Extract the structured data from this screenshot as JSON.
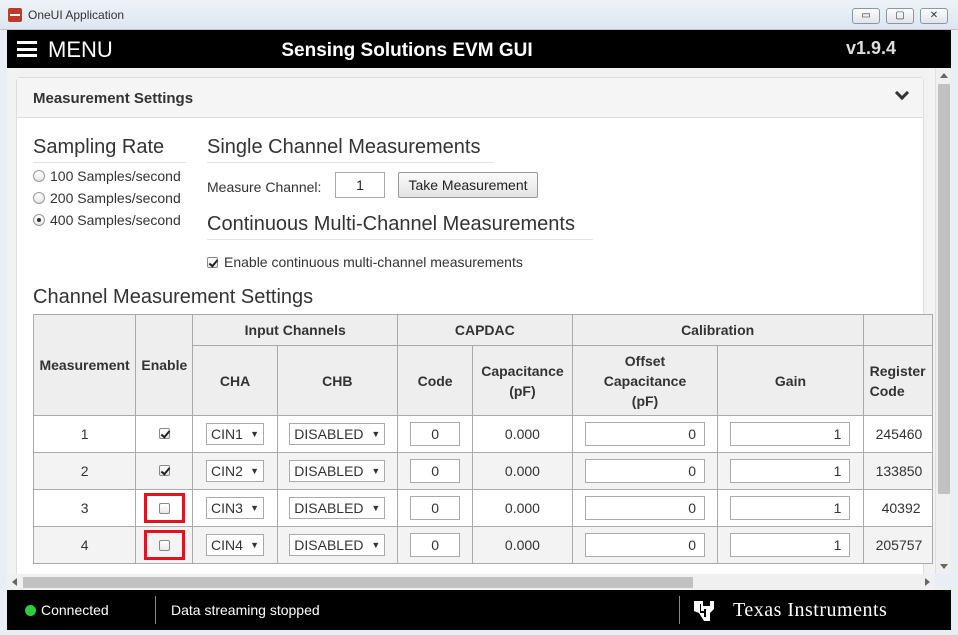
{
  "window": {
    "title": "OneUI Application",
    "min": "▭",
    "max": "▢",
    "close": "✕"
  },
  "header": {
    "menu_label": "MENU",
    "title": "Sensing Solutions EVM GUI",
    "version": "v1.9.4"
  },
  "panel": {
    "title": "Measurement Settings"
  },
  "sampling": {
    "title": "Sampling Rate",
    "options": [
      {
        "label": "100 Samples/second",
        "selected": false
      },
      {
        "label": "200 Samples/second",
        "selected": false
      },
      {
        "label": "400 Samples/second",
        "selected": true
      }
    ]
  },
  "single": {
    "title": "Single Channel Measurements",
    "channel_label": "Measure Channel:",
    "channel_value": "1",
    "button": "Take Measurement"
  },
  "continuous": {
    "title": "Continuous Multi-Channel Measurements",
    "checkbox_label": "Enable continuous multi-channel measurements",
    "checked": true
  },
  "channels": {
    "title": "Channel Measurement Settings",
    "headers": {
      "measurement": "Measurement",
      "enable": "Enable",
      "input_channels": "Input Channels",
      "cha": "CHA",
      "chb": "CHB",
      "capdac": "CAPDAC",
      "code": "Code",
      "capacitance": "Capacitance (pF)",
      "calibration": "Calibration",
      "offset": "Offset Capacitance (pF)",
      "gain": "Gain",
      "register": "Register Code"
    },
    "rows": [
      {
        "measurement": "1",
        "enabled": true,
        "cha": "CIN1",
        "chb": "DISABLED",
        "code": "0",
        "capacitance": "0.000",
        "offset": "0",
        "gain": "1",
        "register": "245460"
      },
      {
        "measurement": "2",
        "enabled": true,
        "cha": "CIN2",
        "chb": "DISABLED",
        "code": "0",
        "capacitance": "0.000",
        "offset": "0",
        "gain": "1",
        "register": "133850"
      },
      {
        "measurement": "3",
        "enabled": false,
        "cha": "CIN3",
        "chb": "DISABLED",
        "code": "0",
        "capacitance": "0.000",
        "offset": "0",
        "gain": "1",
        "register": "40392"
      },
      {
        "measurement": "4",
        "enabled": false,
        "cha": "CIN4",
        "chb": "DISABLED",
        "code": "0",
        "capacitance": "0.000",
        "offset": "0",
        "gain": "1",
        "register": "205757"
      }
    ]
  },
  "status": {
    "connection": "Connected",
    "streaming": "Data streaming stopped",
    "brand": "Texas Instruments"
  },
  "colors": {
    "connected_dot": "#2ecc40",
    "highlight": "#e0141e"
  }
}
